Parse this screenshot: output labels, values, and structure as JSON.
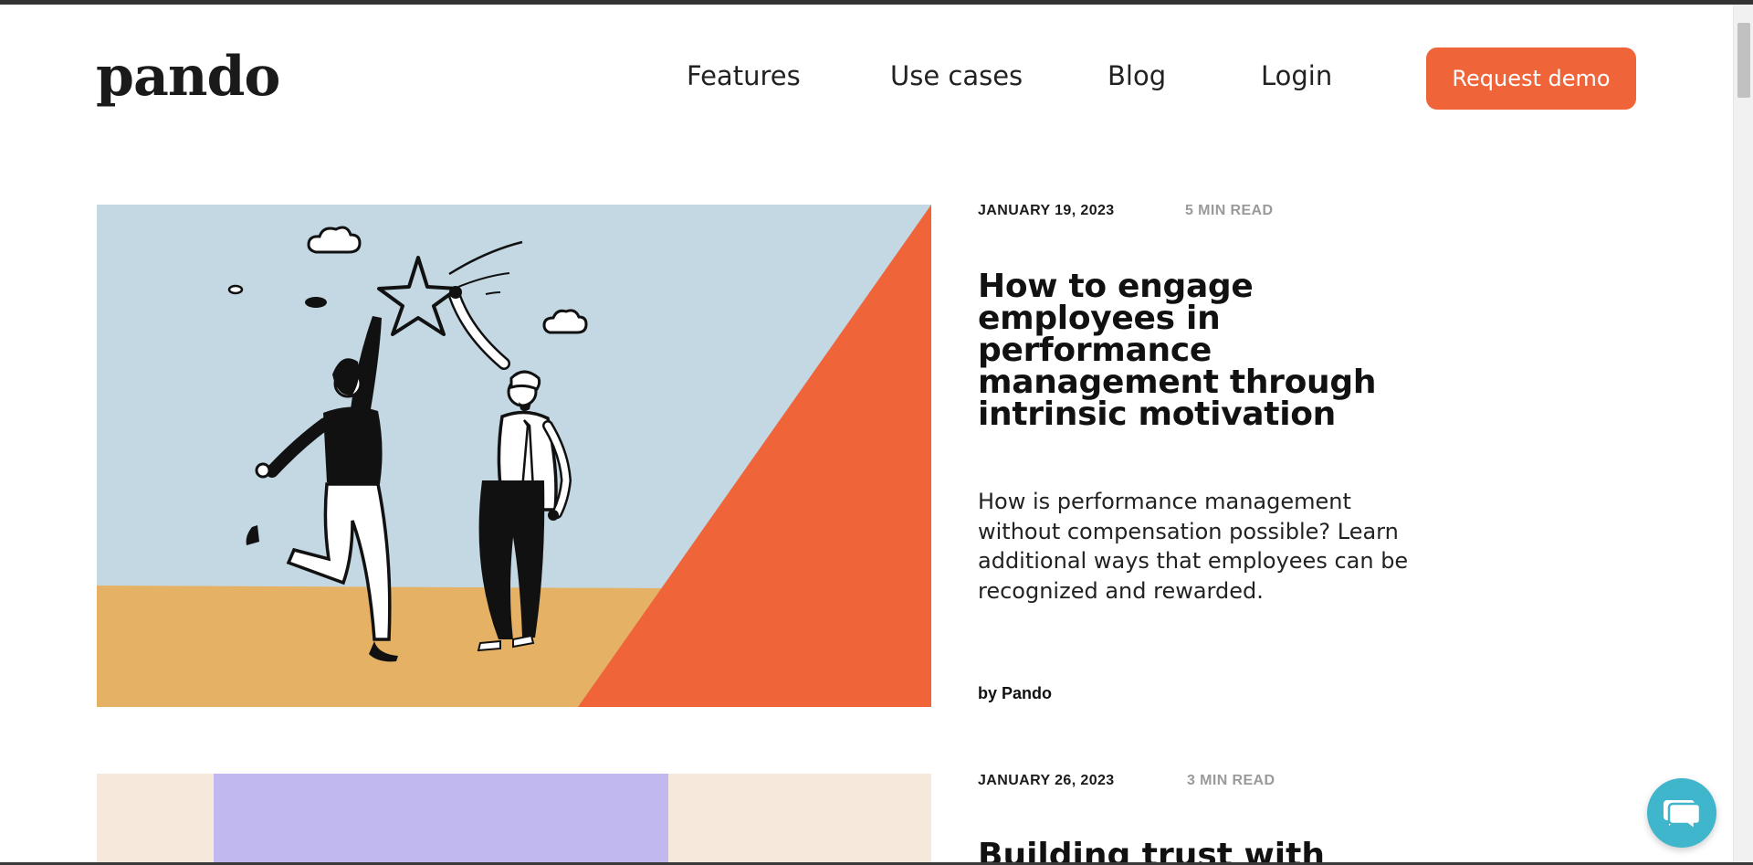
{
  "header": {
    "logo_text": "pando",
    "nav": {
      "features": "Features",
      "use_cases": "Use cases",
      "blog": "Blog",
      "login": "Login"
    },
    "cta_label": "Request demo"
  },
  "colors": {
    "accent": "#f0643a",
    "sky": "#c3d8e3",
    "ground": "#e5b265",
    "lavender": "#c0b8ee",
    "cream": "#f6e8da",
    "chat": "#3fb6cc"
  },
  "posts": [
    {
      "date": "JANUARY 19, 2023",
      "read_time": "5 MIN READ",
      "title": "How to engage employees in performance management through intrinsic motivation",
      "excerpt": "How is performance management without compensation possible? Learn additional ways that employees can be recognized and rewarded.",
      "author": "by Pando",
      "image_icon": "high-five-star-illustration"
    },
    {
      "date": "JANUARY 26, 2023",
      "read_time": "3 MIN READ",
      "title": "Building trust with",
      "image_icon": "abstract-illustration"
    }
  ],
  "chat": {
    "icon": "chat-bubble-icon"
  }
}
